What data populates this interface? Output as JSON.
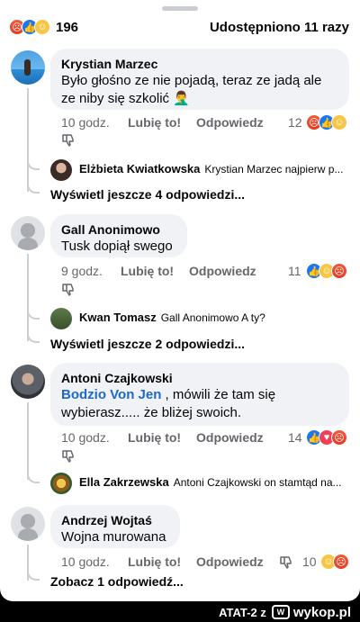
{
  "header": {
    "reaction_count": "196",
    "reactions": [
      "angry",
      "like",
      "haha"
    ],
    "shares": "Udostępniono 11 razy"
  },
  "comments": [
    {
      "author": "Krystian Marzec",
      "text": "Było głośno ze nie pojadą, teraz ze jadą ale ze niby się szkolić 🤦‍♂️",
      "time": "10 godz.",
      "like": "Lubię to!",
      "reply": "Odpowiedz",
      "reaction_count": "12",
      "reactions": [
        "angry",
        "like",
        "haha"
      ],
      "reply_preview": {
        "author": "Elżbieta Kwiatkowska",
        "text": "Krystian Marzec najpierw p..."
      },
      "more": "Wyświetl jeszcze 4 odpowiedzi..."
    },
    {
      "author": "Gall Anonimowo",
      "text": "Tusk dopiął swego",
      "time": "9 godz.",
      "like": "Lubię to!",
      "reply": "Odpowiedz",
      "reaction_count": "11",
      "reactions": [
        "like",
        "haha",
        "angry"
      ],
      "reply_preview": {
        "author": "Kwan Tomasz",
        "text": "Gall Anonimowo A ty?"
      },
      "more": "Wyświetl jeszcze 2 odpowiedzi..."
    },
    {
      "author": "Antoni Czajkowski",
      "mention": "Bodzio Von Jen",
      "text_after_mention": " , mówili że tam się wybierasz..... że bliżej swoich.",
      "time": "10 godz.",
      "like": "Lubię to!",
      "reply": "Odpowiedz",
      "reaction_count": "14",
      "reactions": [
        "like",
        "love",
        "angry"
      ],
      "reply_preview": {
        "author": "Ella Zakrzewska",
        "text": "Antoni Czajkowski on stamtąd na..."
      }
    },
    {
      "author": "Andrzej Wojtaś",
      "text": "Wojna murowana",
      "time": "10 godz.",
      "like": "Lubię to!",
      "reply": "Odpowiedz",
      "reaction_count": "10",
      "reactions": [
        "haha",
        "angry"
      ],
      "more": "Zobacz 1 odpowiedź..."
    }
  ],
  "footer": {
    "author": "ATAT-2",
    "prefix": "z",
    "site": "wykop.pl"
  },
  "colors": {
    "like": "#1877f2",
    "angry": "#e8502e",
    "haha": "#f7c645",
    "love": "#f33e58",
    "mention": "#1b6ac9"
  }
}
